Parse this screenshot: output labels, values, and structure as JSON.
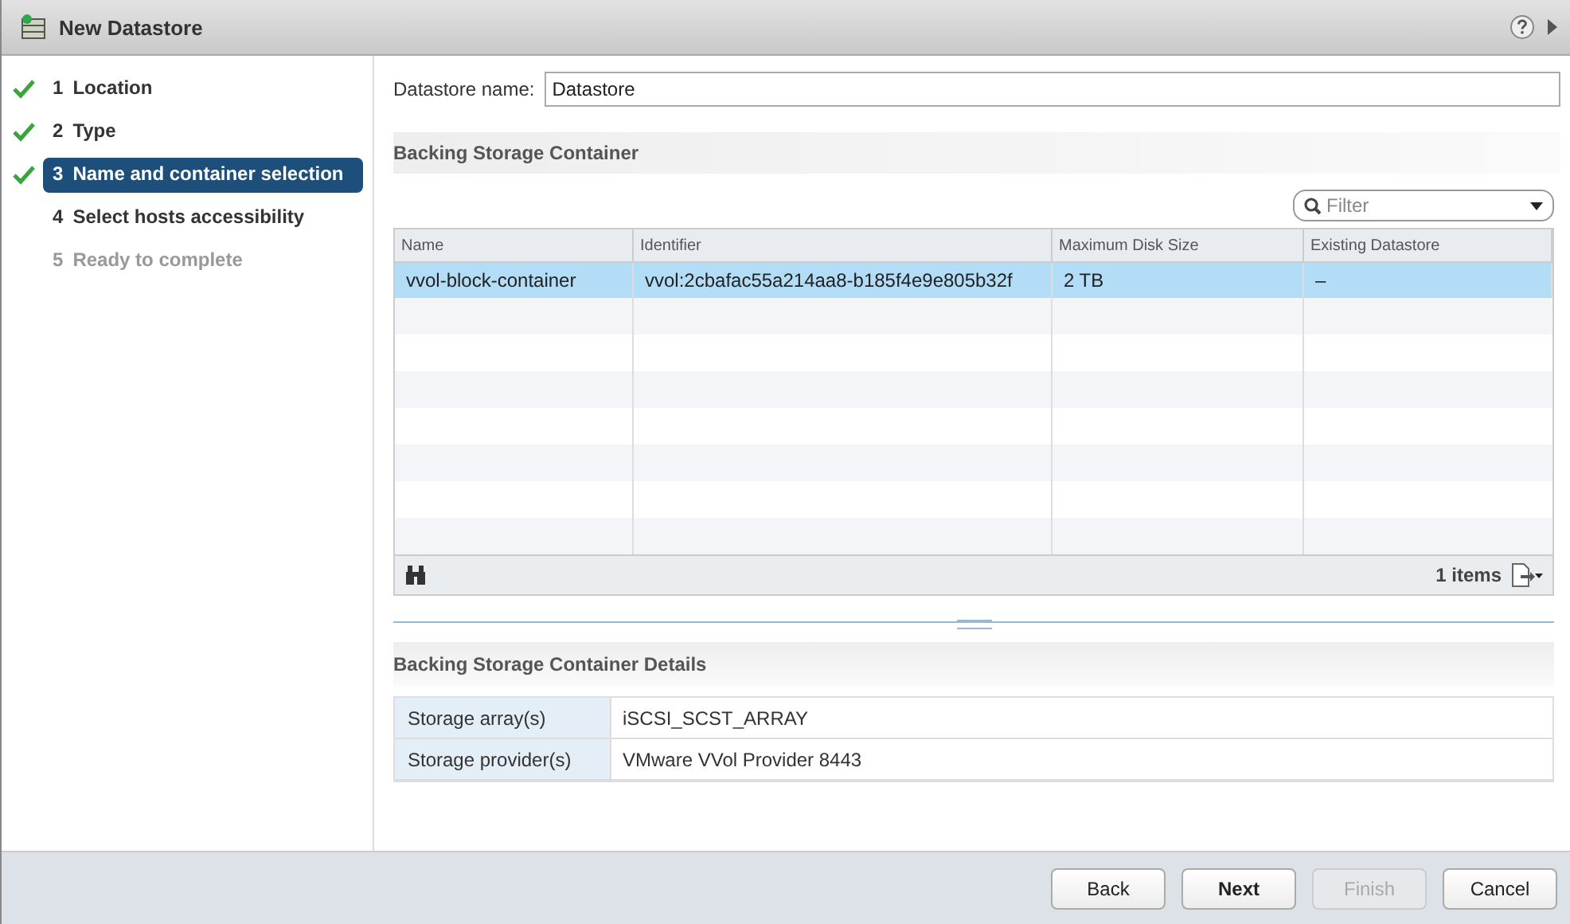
{
  "window": {
    "title": "New Datastore"
  },
  "steps": [
    {
      "number": "1",
      "label": "Location",
      "done": true,
      "selected": false,
      "disabled": false
    },
    {
      "number": "2",
      "label": "Type",
      "done": true,
      "selected": false,
      "disabled": false
    },
    {
      "number": "3",
      "label": "Name and container selection",
      "done": true,
      "selected": true,
      "disabled": false
    },
    {
      "number": "4",
      "label": "Select hosts accessibility",
      "done": false,
      "selected": false,
      "disabled": false
    },
    {
      "number": "5",
      "label": "Ready to complete",
      "done": false,
      "selected": false,
      "disabled": true
    }
  ],
  "name_field": {
    "label": "Datastore name:",
    "value": "Datastore"
  },
  "container_section": {
    "title": "Backing Storage Container"
  },
  "filter": {
    "placeholder": "Filter"
  },
  "table": {
    "columns": [
      "Name",
      "Identifier",
      "Maximum Disk Size",
      "Existing Datastore"
    ],
    "rows": [
      {
        "cells": [
          "vvol-block-container",
          "vvol:2cbafac55a214aa8-b185f4e9e805b32f",
          "2 TB",
          "–"
        ],
        "selected": true
      }
    ],
    "item_count": "1 items"
  },
  "details": {
    "title": "Backing Storage Container Details",
    "rows": [
      {
        "label": "Storage array(s)",
        "value": "iSCSI_SCST_ARRAY"
      },
      {
        "label": "Storage provider(s)",
        "value": "VMware VVol Provider 8443"
      }
    ]
  },
  "buttons": [
    {
      "label": "Back",
      "primary": false,
      "disabled": false
    },
    {
      "label": "Next",
      "primary": true,
      "disabled": false
    },
    {
      "label": "Finish",
      "primary": false,
      "disabled": true
    },
    {
      "label": "Cancel",
      "primary": false,
      "disabled": false
    }
  ]
}
